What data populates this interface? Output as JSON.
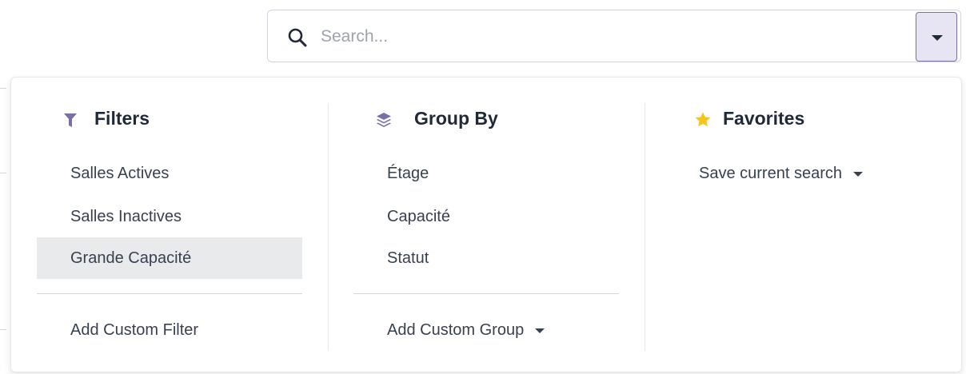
{
  "search": {
    "placeholder": "Search..."
  },
  "filters": {
    "title": "Filters",
    "icon": "filter-icon",
    "icon_color": "#7c6fa6",
    "items": [
      "Salles Actives",
      "Salles Inactives",
      "Grande Capacité"
    ],
    "selected_index": 2,
    "custom_label": "Add Custom Filter"
  },
  "group_by": {
    "title": "Group By",
    "icon": "layers-icon",
    "icon_color": "#7c6fa6",
    "items": [
      "Étage",
      "Capacité",
      "Statut"
    ],
    "custom_label": "Add Custom Group"
  },
  "favorites": {
    "title": "Favorites",
    "icon": "star-icon",
    "icon_color": "#f5c518",
    "save_label": "Save current search"
  },
  "colors": {
    "accent": "#7c6fa6",
    "selected_bg": "#e9eaeb",
    "toggle_bg": "#e7e4f3"
  }
}
